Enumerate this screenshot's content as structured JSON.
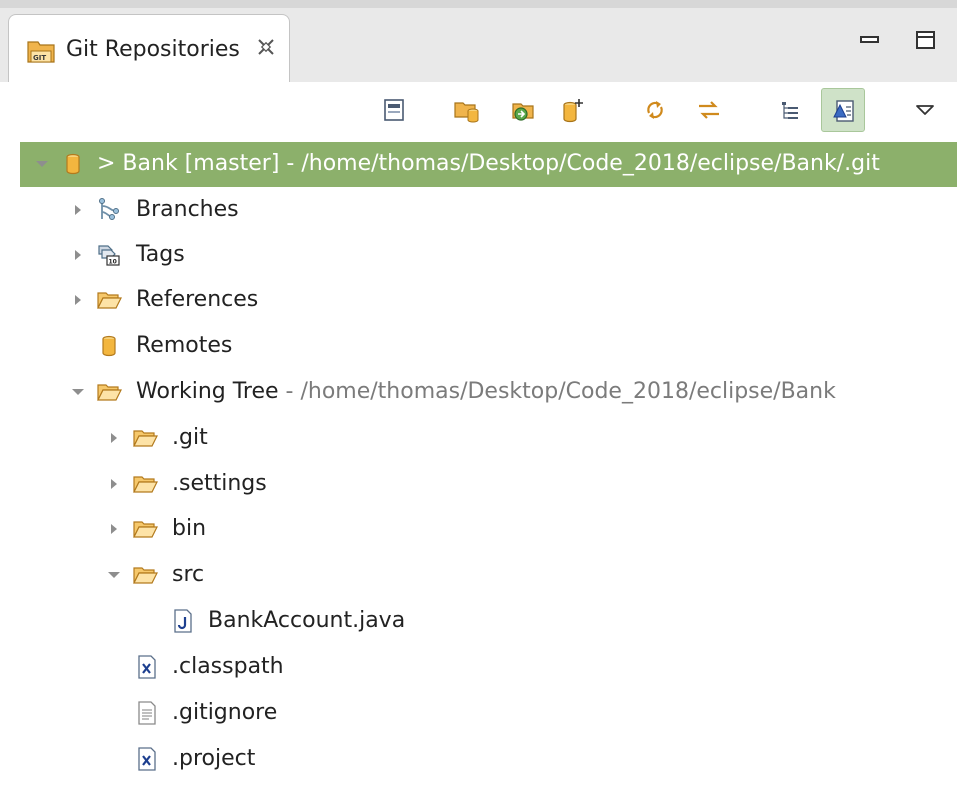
{
  "tab": {
    "title": "Git Repositories",
    "icon": "git-repositories-icon",
    "close_icon": "close-x-icon"
  },
  "view_controls": [
    {
      "name": "minimize-button",
      "icon": "minimize-icon"
    },
    {
      "name": "maximize-button",
      "icon": "maximize-icon"
    }
  ],
  "toolbar": {
    "buttons": [
      {
        "name": "collapse-all-button",
        "icon": "collapse-all-icon"
      },
      {
        "name": "add-existing-repository-button",
        "icon": "add-repository-icon"
      },
      {
        "name": "clone-repository-button",
        "icon": "clone-repository-icon"
      },
      {
        "name": "create-repository-button",
        "icon": "create-repository-icon"
      },
      {
        "name": "refresh-button",
        "icon": "refresh-icon"
      },
      {
        "name": "link-with-selection-button",
        "icon": "link-with-selection-icon"
      },
      {
        "name": "hierarchical-layout-button",
        "icon": "hierarchical-icon"
      },
      {
        "name": "show-repository-details-button",
        "icon": "details-icon",
        "active": true
      },
      {
        "name": "view-menu-button",
        "icon": "triangle-down-icon"
      }
    ]
  },
  "tree": {
    "repository": {
      "label": "> Bank [master]",
      "path": " - /home/thomas/Desktop/Code_2018/eclipse/Bank/.git",
      "icon": "repository-icon",
      "expanded": true
    },
    "branches": {
      "label": "Branches",
      "icon": "branches-icon"
    },
    "tags": {
      "label": "Tags",
      "icon": "tags-icon"
    },
    "references": {
      "label": "References",
      "icon": "folder-icon"
    },
    "remotes": {
      "label": "Remotes",
      "icon": "remotes-icon"
    },
    "working_tree": {
      "label": "Working Tree",
      "path": " - /home/thomas/Desktop/Code_2018/eclipse/Bank",
      "icon": "folder-icon",
      "expanded": true
    },
    "git_folder": {
      "label": ".git",
      "icon": "folder-icon"
    },
    "settings_folder": {
      "label": ".settings",
      "icon": "folder-icon"
    },
    "bin_folder": {
      "label": "bin",
      "icon": "folder-icon"
    },
    "src_folder": {
      "label": "src",
      "icon": "folder-icon",
      "expanded": true
    },
    "bank_account_file": {
      "label": "BankAccount.java",
      "icon": "java-file-icon"
    },
    "classpath_file": {
      "label": ".classpath",
      "icon": "xml-file-icon"
    },
    "gitignore_file": {
      "label": ".gitignore",
      "icon": "text-file-icon"
    },
    "project_file": {
      "label": ".project",
      "icon": "xml-file-icon"
    }
  },
  "colors": {
    "selection": "#8cb06b",
    "tab_bar": "#e9e9e9",
    "folder": "#f0b44c",
    "suffix_text": "#7b7b7b"
  }
}
